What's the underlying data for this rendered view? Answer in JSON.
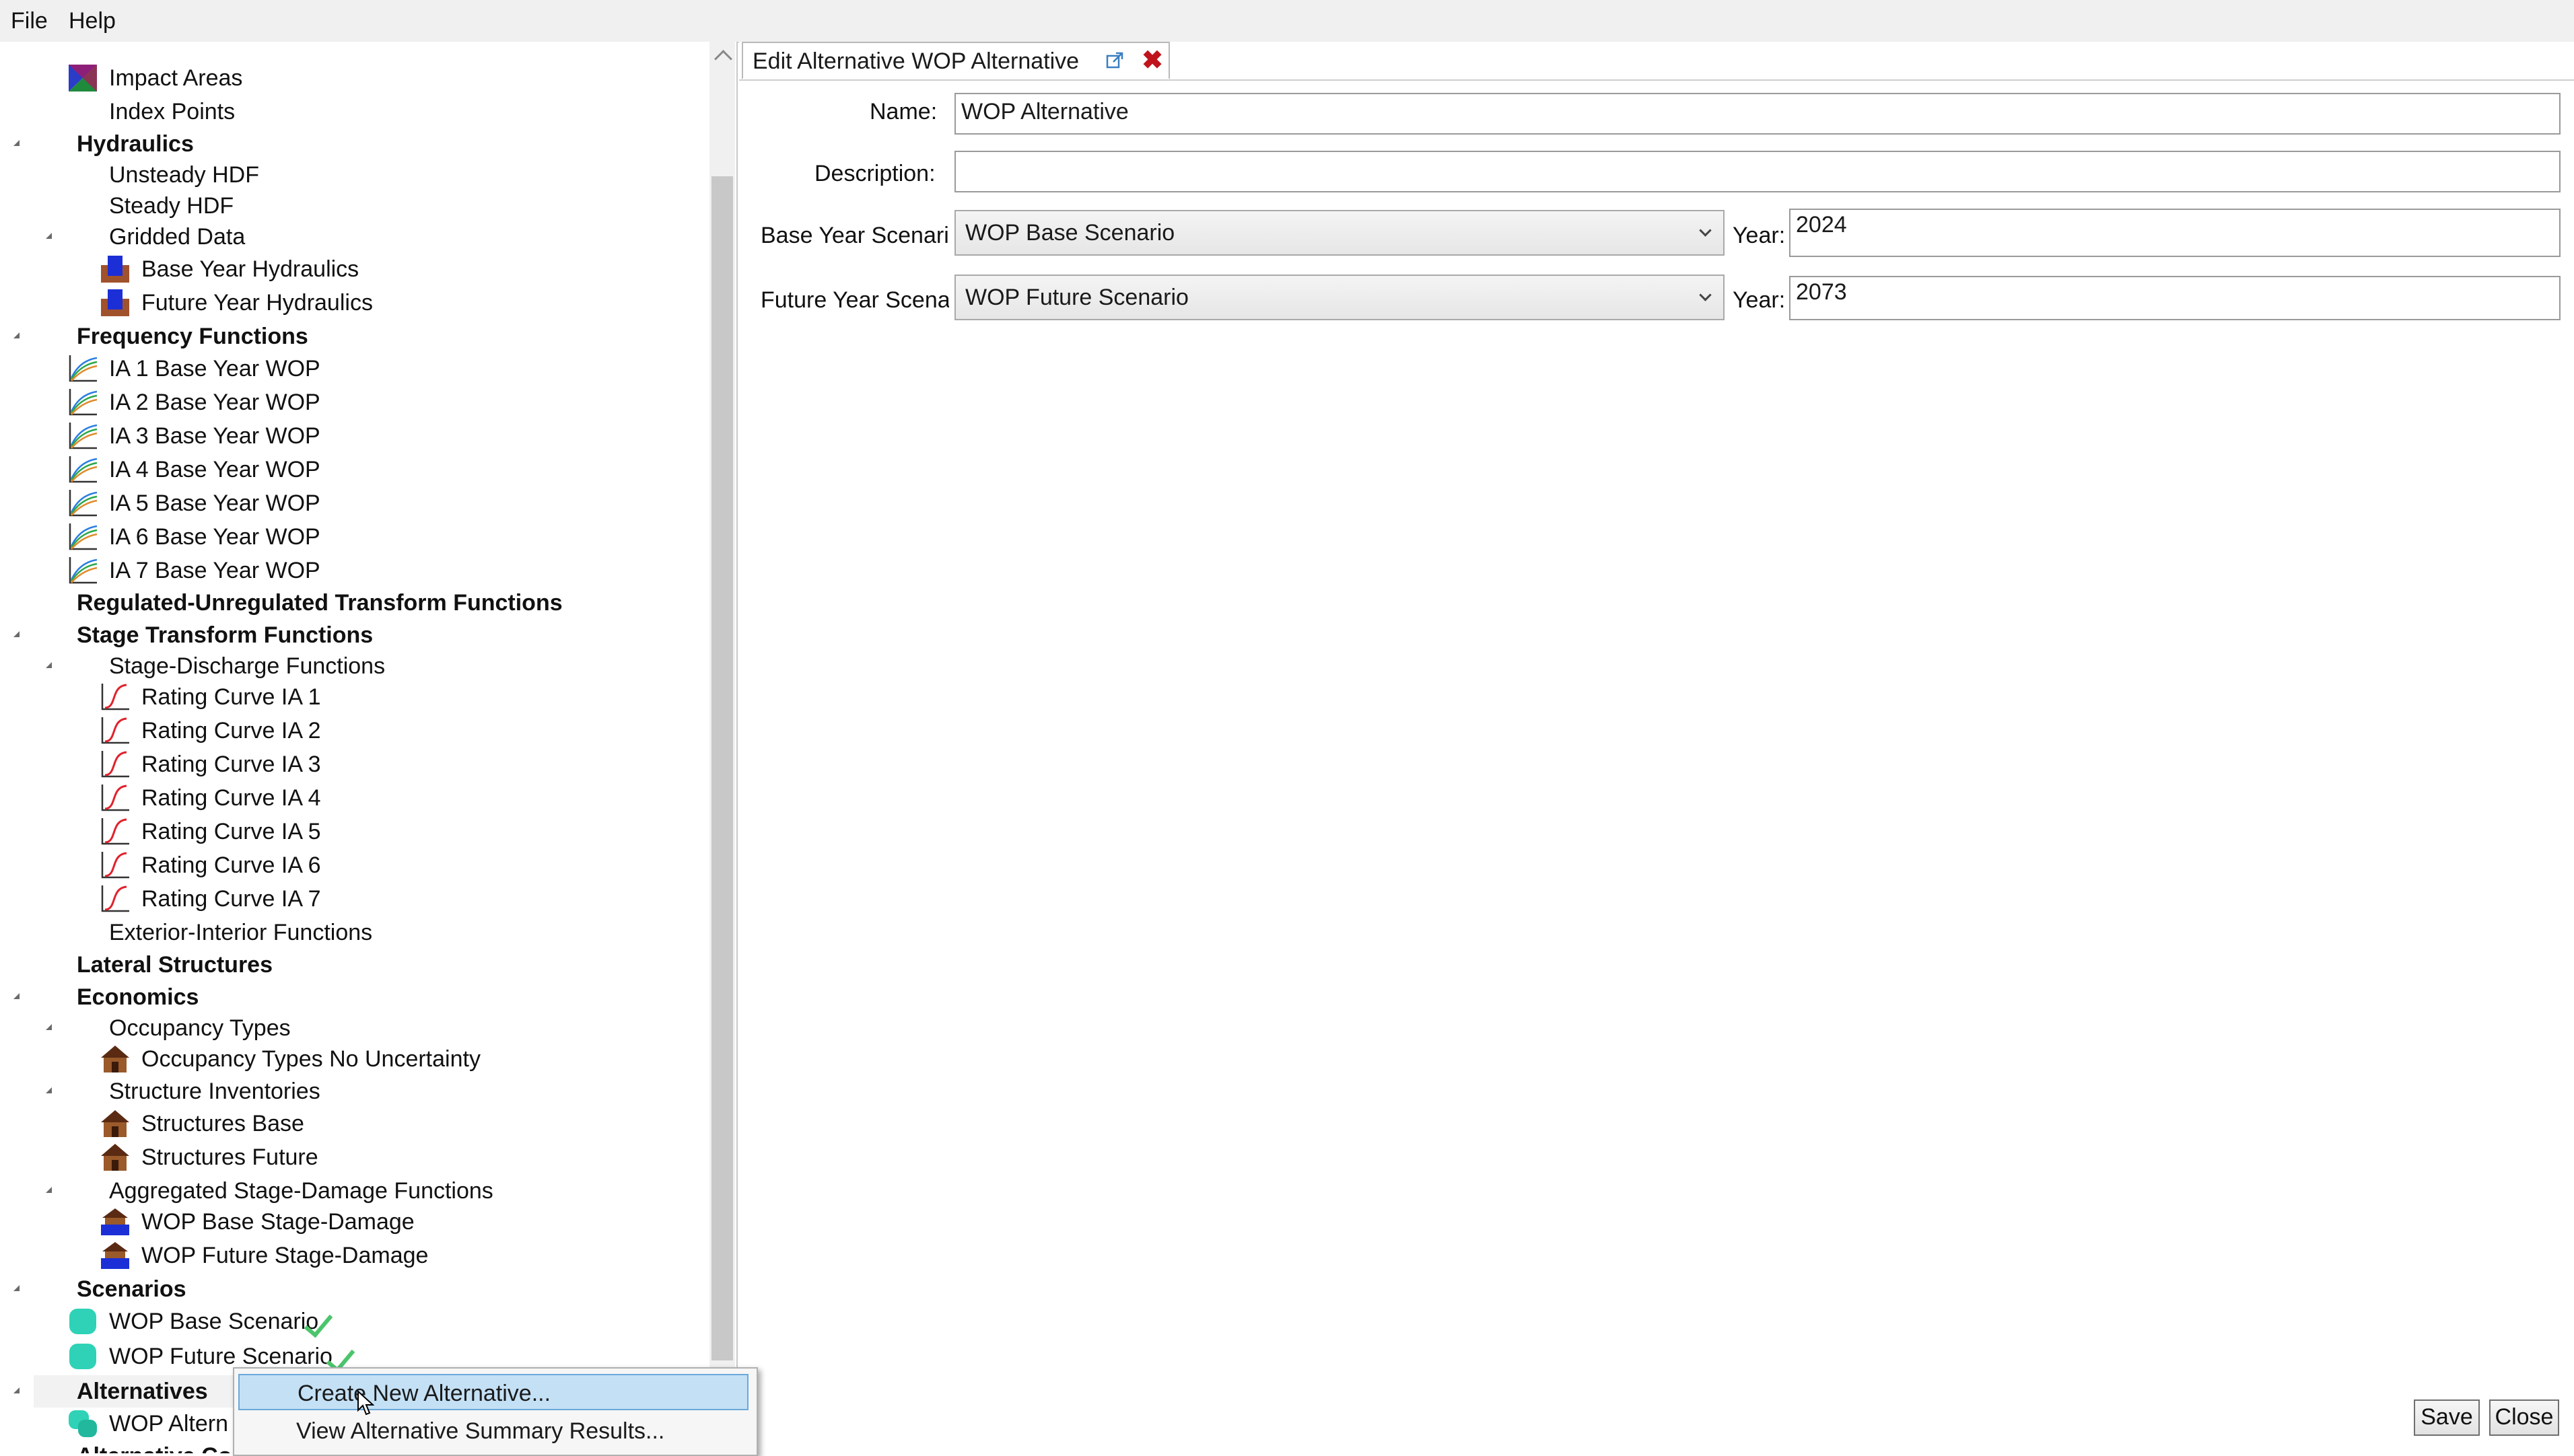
{
  "menu": {
    "file": "File",
    "help": "Help"
  },
  "tree": {
    "rows": [
      {
        "label": "Impact Areas",
        "icon": "impact-areas-icon"
      },
      {
        "label": "Index Points"
      },
      {
        "label": "Hydraulics",
        "bold": true,
        "expanded": true
      },
      {
        "label": "Unsteady HDF"
      },
      {
        "label": "Steady HDF"
      },
      {
        "label": "Gridded Data",
        "expanded": true
      },
      {
        "label": "Base Year Hydraulics",
        "icon": "hydraulics-icon"
      },
      {
        "label": "Future Year Hydraulics",
        "icon": "hydraulics-icon"
      },
      {
        "label": "Frequency Functions",
        "bold": true,
        "expanded": true
      },
      {
        "label": "IA 1 Base Year WOP",
        "icon": "frequency-curve-icon"
      },
      {
        "label": "IA 2 Base Year WOP",
        "icon": "frequency-curve-icon"
      },
      {
        "label": "IA 3 Base Year WOP",
        "icon": "frequency-curve-icon"
      },
      {
        "label": "IA 4 Base Year WOP",
        "icon": "frequency-curve-icon"
      },
      {
        "label": "IA 5 Base Year WOP",
        "icon": "frequency-curve-icon"
      },
      {
        "label": "IA 6 Base Year WOP",
        "icon": "frequency-curve-icon"
      },
      {
        "label": "IA 7 Base Year WOP",
        "icon": "frequency-curve-icon"
      },
      {
        "label": "Regulated-Unregulated Transform Functions",
        "bold": true
      },
      {
        "label": "Stage Transform Functions",
        "bold": true,
        "expanded": true
      },
      {
        "label": "Stage-Discharge Functions",
        "expanded": true
      },
      {
        "label": "Rating Curve IA 1",
        "icon": "rating-curve-icon"
      },
      {
        "label": "Rating Curve IA 2",
        "icon": "rating-curve-icon"
      },
      {
        "label": "Rating Curve IA 3",
        "icon": "rating-curve-icon"
      },
      {
        "label": "Rating Curve IA 4",
        "icon": "rating-curve-icon"
      },
      {
        "label": "Rating Curve IA 5",
        "icon": "rating-curve-icon"
      },
      {
        "label": "Rating Curve IA 6",
        "icon": "rating-curve-icon"
      },
      {
        "label": "Rating Curve IA 7",
        "icon": "rating-curve-icon"
      },
      {
        "label": "Exterior-Interior Functions"
      },
      {
        "label": "Lateral Structures",
        "bold": true
      },
      {
        "label": "Economics",
        "bold": true,
        "expanded": true
      },
      {
        "label": "Occupancy Types",
        "expanded": true
      },
      {
        "label": "Occupancy Types No Uncertainty",
        "icon": "house-icon"
      },
      {
        "label": "Structure Inventories",
        "expanded": true
      },
      {
        "label": "Structures Base",
        "icon": "house-icon"
      },
      {
        "label": "Structures Future",
        "icon": "house-icon"
      },
      {
        "label": "Aggregated Stage-Damage Functions",
        "expanded": true
      },
      {
        "label": "WOP Base Stage-Damage",
        "icon": "stage-damage-icon"
      },
      {
        "label": "WOP Future Stage-Damage",
        "icon": "stage-damage-icon"
      },
      {
        "label": "Scenarios",
        "bold": true,
        "expanded": true
      },
      {
        "label": "WOP Base Scenario",
        "icon": "scenario-icon",
        "check": true
      },
      {
        "label": "WOP Future Scenario",
        "icon": "scenario-icon",
        "check": true
      },
      {
        "label": "Alternatives",
        "bold": true,
        "expanded": true,
        "selected": true
      },
      {
        "label": "WOP Altern",
        "icon": "alternative-icon"
      },
      {
        "label": "Alternative Co",
        "bold": true
      }
    ]
  },
  "editor": {
    "tab_title": "Edit Alternative WOP Alternative",
    "name_label": "Name:",
    "name_value": "WOP Alternative",
    "description_label": "Description:",
    "description_value": "",
    "base_year_label": "Base Year Scenario",
    "base_scenario": "WOP Base Scenario",
    "year_label": "Year:",
    "base_year": "2024",
    "future_year_label": "Future Year Scenario",
    "future_scenario": "WOP Future Scenario",
    "future_year": "2073",
    "save_label": "Save",
    "close_label": "Close"
  },
  "context_menu": {
    "create": "Create New Alternative...",
    "view": "View Alternative Summary Results..."
  },
  "colors": {
    "selection": "#c4e0f5",
    "check": "#4cc46c",
    "close_tab": "#c0141c"
  }
}
